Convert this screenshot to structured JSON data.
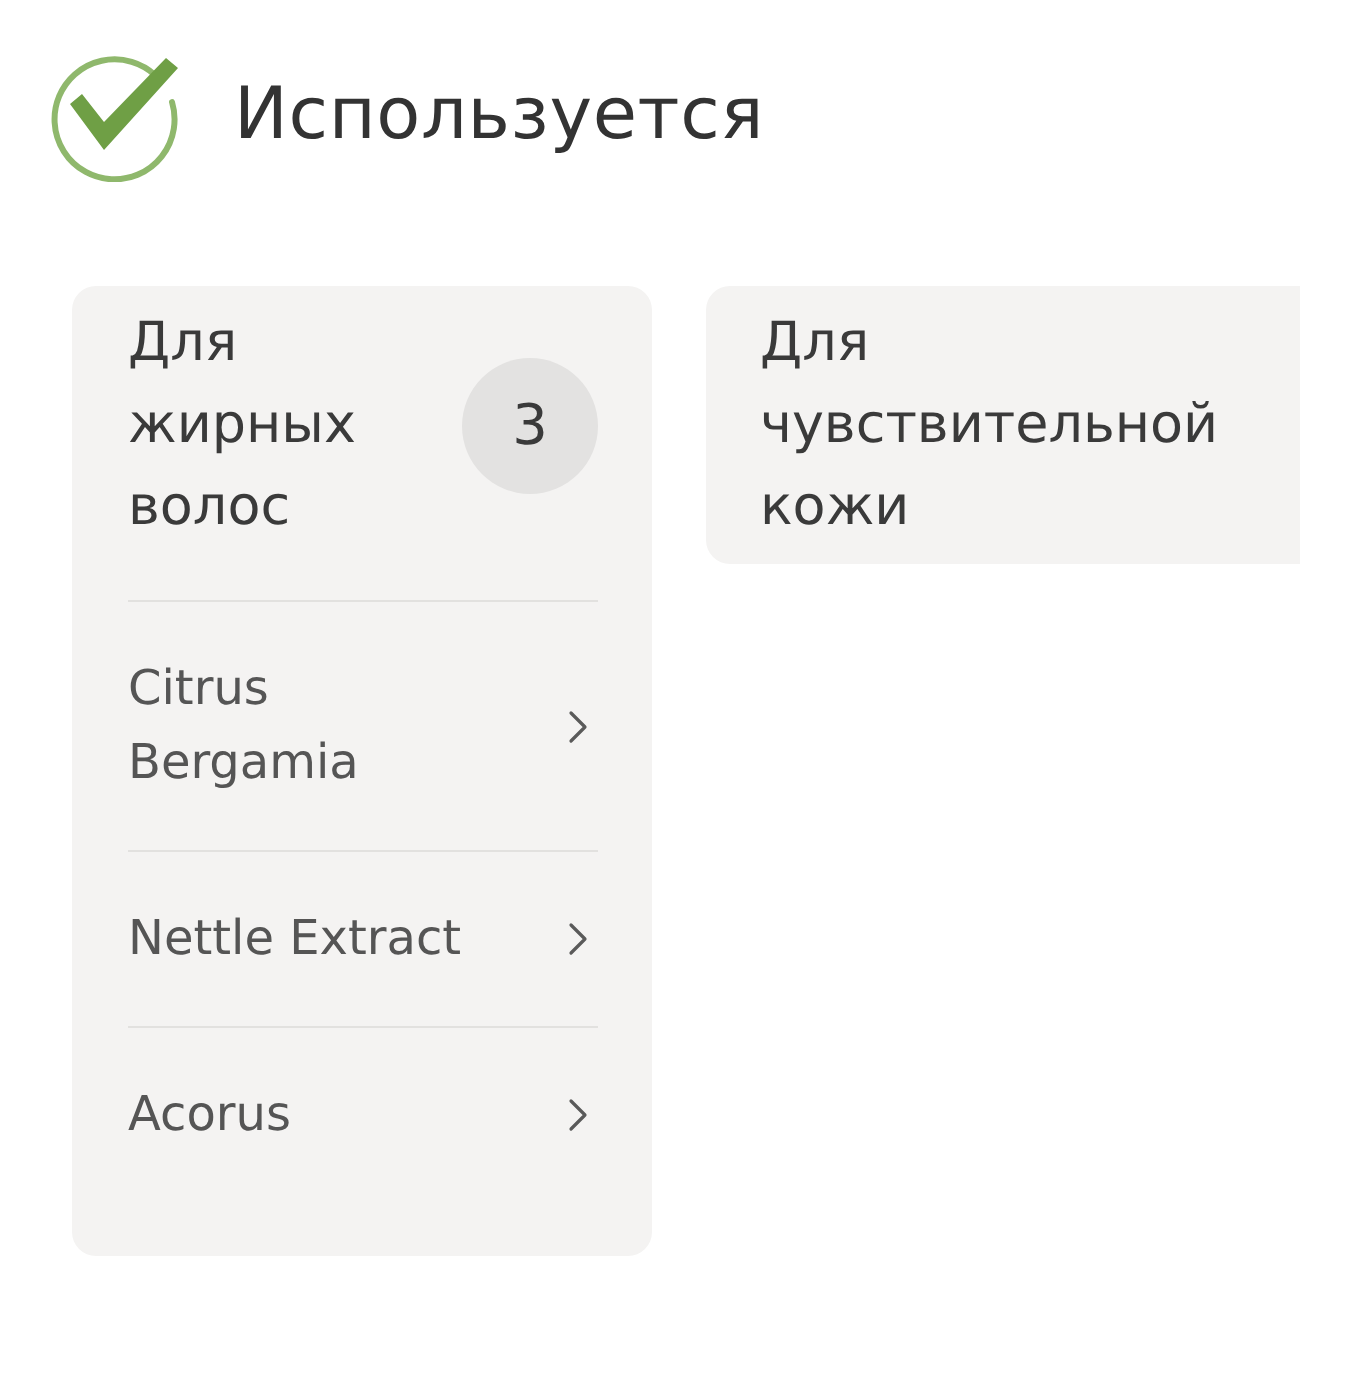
{
  "status": {
    "label": "Используется"
  },
  "categories": [
    {
      "title": "Для жирных волос",
      "count": "3",
      "items": [
        {
          "label": "Citrus Bergamia"
        },
        {
          "label": "Nettle Extract"
        },
        {
          "label": "Acorus"
        }
      ]
    },
    {
      "title": "Для чувствительной кожи"
    }
  ]
}
